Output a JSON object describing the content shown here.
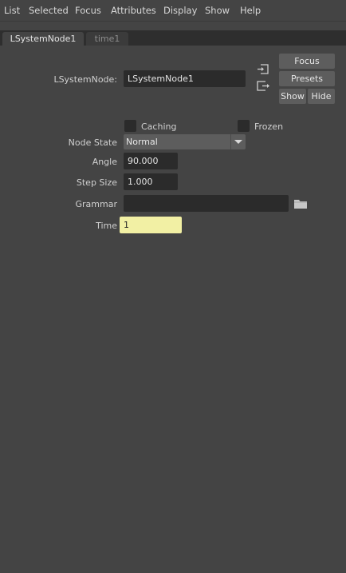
{
  "menu": [
    "List",
    "Selected",
    "Focus",
    "Attributes",
    "Display",
    "Show",
    "Help"
  ],
  "tabs": {
    "active": "LSystemNode1",
    "inactive": "time1"
  },
  "node": {
    "label": "LSystemNode:",
    "name": "LSystemNode1"
  },
  "buttons": {
    "focus": "Focus",
    "presets": "Presets",
    "show": "Show",
    "hide": "Hide"
  },
  "attributes": {
    "caching_label": "Caching",
    "frozen_label": "Frozen",
    "node_state_label": "Node State",
    "node_state_value": "Normal",
    "angle_label": "Angle",
    "angle_value": "90.000",
    "step_size_label": "Step Size",
    "step_size_value": "1.000",
    "grammar_label": "Grammar",
    "grammar_value": "",
    "time_label": "Time",
    "time_value": "1"
  },
  "icons": {
    "input_connections": "input-connections-icon",
    "output_connections": "output-connections-icon",
    "folder": "folder-icon",
    "dropdown": "chevron-down-icon"
  }
}
